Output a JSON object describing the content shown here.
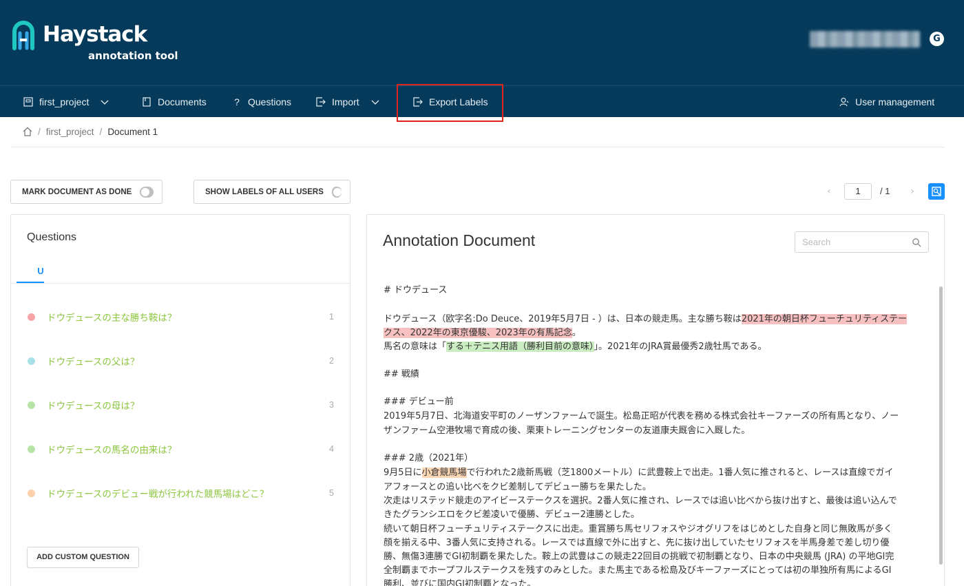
{
  "header": {
    "brand": "Haystack",
    "subtitle": "annotation tool"
  },
  "nav": {
    "project": "first_project",
    "documents": "Documents",
    "questions": "Questions",
    "import": "Import",
    "export": "Export Labels",
    "user_management": "User management"
  },
  "breadcrumb": {
    "sep": "/",
    "project": "first_project",
    "current": "Document 1"
  },
  "toolbar": {
    "mark_done": "MARK DOCUMENT AS DONE",
    "show_labels": "SHOW LABELS OF ALL USERS"
  },
  "pager": {
    "page": "1",
    "total": "/ 1"
  },
  "questions_panel": {
    "title": "Questions",
    "tab": "U",
    "items": [
      {
        "text": "ドウデュースの主な勝ち鞍は？",
        "num": "1",
        "color": "#f5a5a5"
      },
      {
        "text": "ドウデュースの父は？",
        "num": "2",
        "color": "#a9e2ea"
      },
      {
        "text": "ドウデュースの母は？",
        "num": "3",
        "color": "#b7e4a7"
      },
      {
        "text": "ドウデュースの馬名の由来は？",
        "num": "4",
        "color": "#b7e4a7"
      },
      {
        "text": "ドウデュースのデビュー戦が行われた競馬場はどこ？",
        "num": "5",
        "color": "#fbd0aa"
      }
    ],
    "add_button": "ADD CUSTOM QUESTION"
  },
  "document": {
    "title": "Annotation Document",
    "search_placeholder": "Search",
    "l1": "# ドウデュース",
    "l2a": "ドウデュース（欧字名:Do Deuce、2019年5月7日 - ）は、日本の競走馬。主な勝ち鞍は",
    "l2b": "2021年の朝日杯フューチュリティステー",
    "l3a": "クス、2022年の東京優駿、2023年の有馬記念",
    "l3b": "。",
    "l4a": "馬名の意味は「",
    "l4b": "する＋テニス用語（勝利目前の意味）",
    "l4c": "」。2021年のJRA賞最優秀2歳牡馬である。",
    "l5": "## 戦績",
    "l6": "### デビュー前",
    "l7": "2019年5月7日、北海道安平町のノーザンファームで誕生。松島正昭が代表を務める株式会社キーファーズの所有馬となり、ノー",
    "l8": "ザンファーム空港牧場で育成の後、栗東トレーニングセンターの友道康夫厩舎に入厩した。",
    "l9": "### 2歳（2021年）",
    "l10a": "9月5日に",
    "l10b": "小倉競馬場",
    "l10c": "で行われた2歳新馬戦（芝1800メートル）に武豊鞍上で出走。1番人気に推されると、レースは直線でガイ",
    "l11": "アフォースとの追い比べをクビ差制してデビュー勝ちを果たした。",
    "l12": "次走はリステッド競走のアイビーステークスを選択。2番人気に推され、レースでは追い比べから抜け出すと、最後は追い込んで",
    "l13": "きたグランシエロをクビ差凌いで優勝、デビュー2連勝とした。",
    "l14": "続いて朝日杯フューチュリティステークスに出走。重賞勝ち馬セリフォスやジオグリフをはじめとした自身と同じ無敗馬が多く",
    "l15": "顔を揃える中、3番人気に支持される。レースでは直線で外に出すと、先に抜け出していたセリフォスを半馬身差で差し切り優",
    "l16": "勝、無傷3連勝でGI初制覇を果たした。鞍上の武豊はこの競走22回目の挑戦で初制覇となり、日本の中央競馬 (JRA) の平地GI完",
    "l17": "全制覇までホープフルステークスを残すのみとした。また馬主である松島及びキーファーズにとっては初の単独所有馬によるGI",
    "l18": "勝利、並びに国内GI初制覇となった。"
  }
}
